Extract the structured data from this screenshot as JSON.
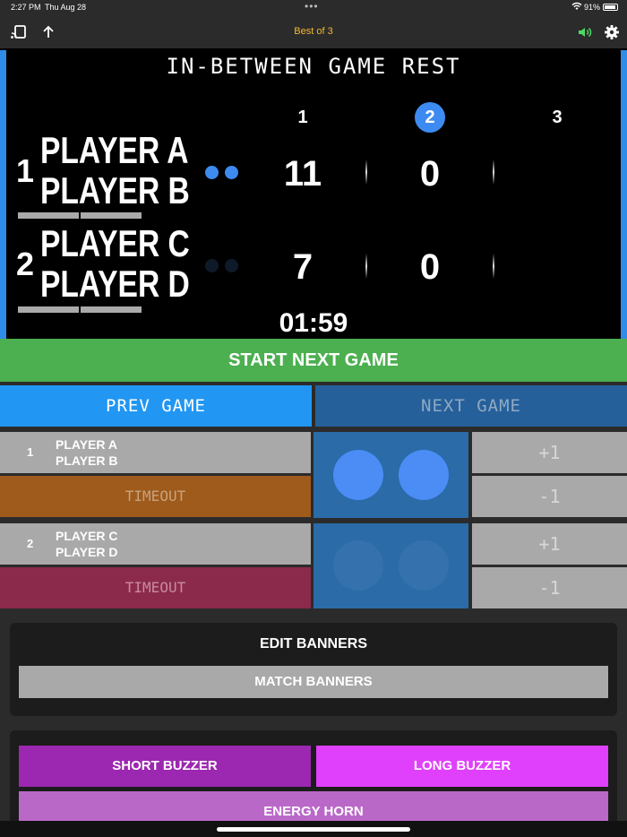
{
  "status_bar": {
    "time": "2:27 PM",
    "date": "Thu Aug 28",
    "battery": "91%"
  },
  "toolbar": {
    "title": "Best of 3"
  },
  "scoreboard": {
    "title": "IN-BETWEEN GAME REST",
    "games": [
      "1",
      "2",
      "3"
    ],
    "active_game": "2",
    "clock": "01:59",
    "teams": [
      {
        "number": "1",
        "player1": "PLAYER A",
        "player2": "PLAYER B",
        "scores": [
          "11",
          "0",
          ""
        ],
        "serve_color": "#3d8bf0"
      },
      {
        "number": "2",
        "player1": "PLAYER C",
        "player2": "PLAYER D",
        "scores": [
          "7",
          "0",
          ""
        ],
        "serve_color": "#0e1a2a"
      }
    ]
  },
  "actions": {
    "start_next_game": "START NEXT GAME",
    "prev_game": "PREV GAME",
    "next_game": "NEXT GAME"
  },
  "controls": {
    "teams": [
      {
        "number": "1",
        "player1": "PLAYER A",
        "player2": "PLAYER B",
        "timeout": "TIMEOUT",
        "timeout_color": "#9e5b1c",
        "plus": "+1",
        "minus": "-1"
      },
      {
        "number": "2",
        "player1": "PLAYER C",
        "player2": "PLAYER D",
        "timeout": "TIMEOUT",
        "timeout_color": "#8b2a4a",
        "plus": "+1",
        "minus": "-1"
      }
    ]
  },
  "banners": {
    "title": "EDIT BANNERS",
    "match_banners": "MATCH BANNERS"
  },
  "sounds": {
    "short_buzzer": "SHORT BUZZER",
    "long_buzzer": "LONG BUZZER",
    "energy_horn": "ENERGY HORN"
  },
  "colors": {
    "accent": "#2196f3",
    "start": "#4caf50",
    "short_buzzer": "#9c27b0",
    "long_buzzer": "#e040fb",
    "energy_horn": "#ba68c8",
    "title": "#f5b82e"
  }
}
